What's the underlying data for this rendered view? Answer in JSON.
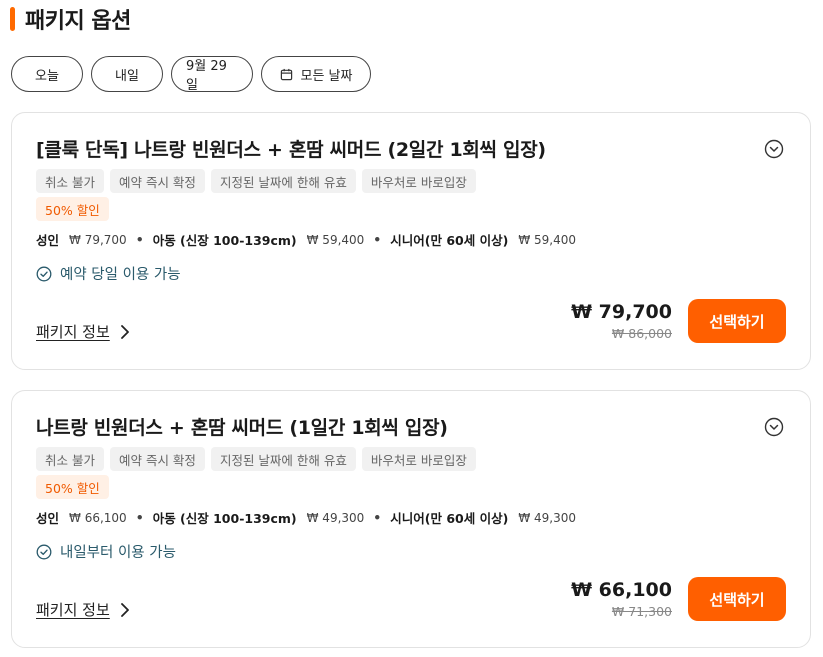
{
  "section": {
    "title": "패키지 옵션"
  },
  "date_filters": {
    "today": "오늘",
    "tomorrow": "내일",
    "date": "9월 29일",
    "all_dates": "모든 날짜"
  },
  "packages": [
    {
      "title": "[클룩 단독] 나트랑 빈원더스 + 혼땀 씨머드 (2일간 1회씩 입장)",
      "tags": [
        "취소 불가",
        "예약 즉시 확정",
        "지정된 날짜에 한해 유효",
        "바우처로 바로입장"
      ],
      "discount": "50% 할인",
      "prices": {
        "adult_label": "성인",
        "adult_price": "₩ 79,700",
        "child_label": "아동 (신장 100-139cm)",
        "child_price": "₩ 59,400",
        "senior_label": "시니어(만 60세 이상)",
        "senior_price": "₩ 59,400"
      },
      "availability": "예약 당일 이용 가능",
      "info_link": "패키지 정보",
      "main_price": "₩ 79,700",
      "original_price": "₩ 86,000",
      "select_label": "선택하기"
    },
    {
      "title": "나트랑 빈원더스 + 혼땀 씨머드 (1일간 1회씩 입장)",
      "tags": [
        "취소 불가",
        "예약 즉시 확정",
        "지정된 날짜에 한해 유효",
        "바우처로 바로입장"
      ],
      "discount": "50% 할인",
      "prices": {
        "adult_label": "성인",
        "adult_price": "₩ 66,100",
        "child_label": "아동 (신장 100-139cm)",
        "child_price": "₩ 49,300",
        "senior_label": "시니어(만 60세 이상)",
        "senior_price": "₩ 49,300"
      },
      "availability": "내일부터 이용 가능",
      "info_link": "패키지 정보",
      "main_price": "₩ 66,100",
      "original_price": "₩ 71,300",
      "select_label": "선택하기"
    }
  ],
  "colors": {
    "accent": "#ff5f00",
    "discount_bg": "#fff0e5",
    "availability": "#2a5a6b"
  },
  "icons": {
    "calendar": "calendar-icon",
    "check": "check-circle-icon",
    "expand": "chevron-down-circle-icon",
    "chevron": "chevron-right-icon"
  }
}
